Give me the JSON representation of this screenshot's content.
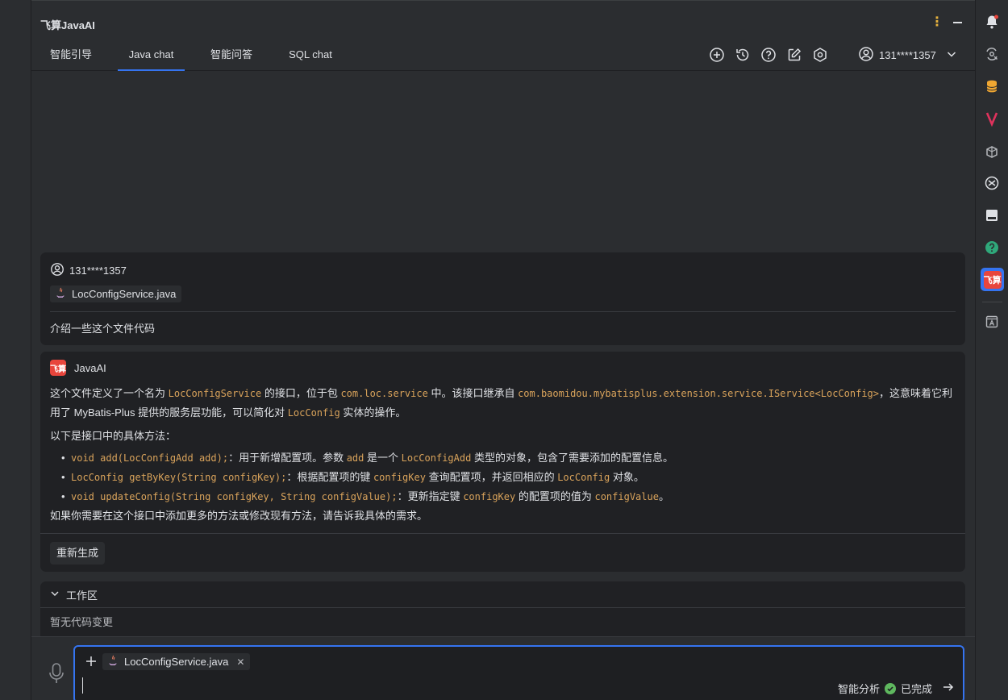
{
  "panel": {
    "title": "飞算JavaAI"
  },
  "tabs": [
    {
      "label": "智能引导"
    },
    {
      "label": "Java chat"
    },
    {
      "label": "智能问答"
    },
    {
      "label": "SQL chat"
    }
  ],
  "user": {
    "name": "131****1357"
  },
  "user_message": {
    "author": "131****1357",
    "file": "LocConfigService.java",
    "text": "介绍一些这个文件代码"
  },
  "ai_message": {
    "author": "JavaAI",
    "logo_text": "飞算",
    "p1": {
      "a": "这个文件定义了一个名为 ",
      "c1": "LocConfigService",
      "b": " 的接口，位于包 ",
      "c2": "com.loc.service",
      "c": " 中。该接口继承自 ",
      "c3": "com.baomidou.mybatisplus.extension.service.IService<LocConfig>",
      "d": "，这意味着它利用了 MyBatis-Plus 提供的服务层功能，可以简化对 ",
      "c4": "LocConfig",
      "e": " 实体的操作。"
    },
    "p2": "以下是接口中的具体方法：",
    "bullets": [
      {
        "code": "void add(LocConfigAdd add);",
        "t1": "：用于新增配置项。参数 ",
        "c1": "add",
        "t2": " 是一个 ",
        "c2": "LocConfigAdd",
        "t3": " 类型的对象，包含了需要添加的配置信息。"
      },
      {
        "code": "LocConfig getByKey(String configKey);",
        "t1": "：根据配置项的键 ",
        "c1": "configKey",
        "t2": " 查询配置项，并返回相应的 ",
        "c2": "LocConfig",
        "t3": " 对象。"
      },
      {
        "code": "void updateConfig(String configKey, String configValue);",
        "t1": "：更新指定键 ",
        "c1": "configKey",
        "t2": " 的配置项的值为 ",
        "c2": "configValue",
        "t3": "。"
      }
    ],
    "p3": "如果你需要在这个接口中添加更多的方法或修改现有方法，请告诉我具体的需求。",
    "regenerate_label": "重新生成"
  },
  "workspace": {
    "title": "工作区",
    "empty_text": "暂无代码变更"
  },
  "input": {
    "file_chip": "LocConfigService.java",
    "analysis_label": "智能分析",
    "status_label": "已完成"
  },
  "right_strip": {
    "badge_text": "飞算"
  },
  "colors": {
    "accent": "#3574f0",
    "code": "#d9a35b",
    "brand_red": "#e8453c",
    "success": "#5fb85f"
  }
}
